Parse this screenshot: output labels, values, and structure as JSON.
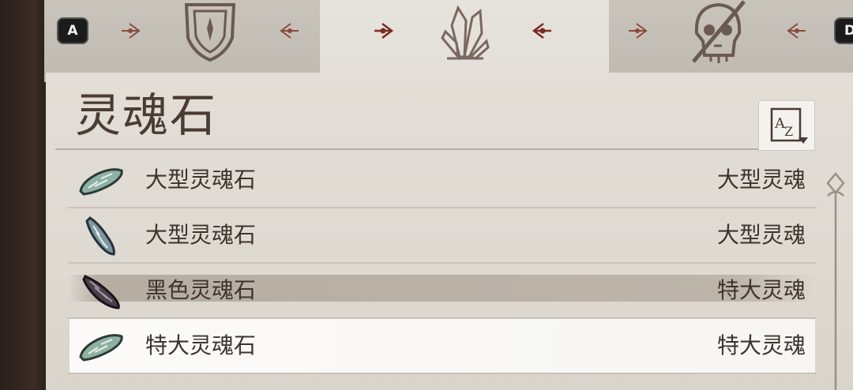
{
  "tabs": {
    "left_key": "A",
    "right_key": "D",
    "items": [
      {
        "icon": "shield-crest-icon"
      },
      {
        "icon": "crystal-icon",
        "active": true
      },
      {
        "icon": "skull-icon"
      }
    ]
  },
  "panel": {
    "title": "灵魂石",
    "sort_icon": "sort-az-icon"
  },
  "items": [
    {
      "name": "大型灵魂石",
      "type": "大型灵魂",
      "icon": "soul-stone-icon",
      "state": "normal"
    },
    {
      "name": "大型灵魂石",
      "type": "大型灵魂",
      "icon": "soul-stone-icon",
      "state": "normal"
    },
    {
      "name": "黑色灵魂石",
      "type": "特大灵魂",
      "icon": "black-soul-stone-icon",
      "state": "hover"
    },
    {
      "name": "特大灵魂石",
      "type": "特大灵魂",
      "icon": "soul-stone-icon",
      "state": "selected"
    }
  ],
  "colors": {
    "parchment": "#e2ded7",
    "text": "#3e332d",
    "accent": "#7a2a22"
  }
}
